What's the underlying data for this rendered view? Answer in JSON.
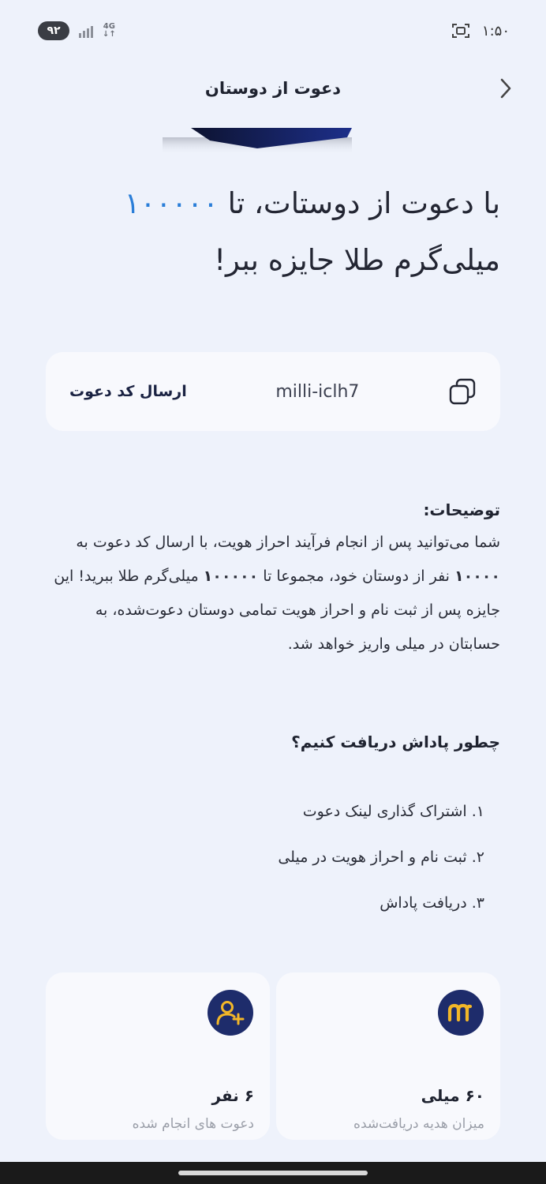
{
  "status_bar": {
    "battery": "۹۲",
    "network": "4G",
    "time": "۱:۵۰"
  },
  "header": {
    "title": "دعوت از دوستان",
    "back_icon": "chevron-right-icon"
  },
  "hero": {
    "text_before": "با دعوت از دوستات، تا ",
    "amount": "۱۰۰۰۰۰",
    "text_after": " میلی‌گرم طلا جایزه ببر!",
    "accent_color": "#2a7ed8"
  },
  "invite": {
    "send_label": "ارسال کد دعوت",
    "code": "milli-iclh7",
    "copy_icon": "copy-icon"
  },
  "description": {
    "title": "توضیحات:",
    "part1": "شما می‌توانید پس از انجام فرآیند احراز هویت، با ارسال کد دعوت به ",
    "invite_count": "۱۰۰۰۰",
    "part2": " نفر از دوستان خود، مجموعا تا ",
    "total_amount": "۱۰۰۰۰۰",
    "part3": " میلی‌گرم طلا ببرید! این جایزه پس از ثبت نام و احراز هویت تمامی دوستان دعوت‌شده، به حسابتان در میلی واریز خواهد شد."
  },
  "how_to": {
    "title": "چطور پاداش دریافت کنیم؟",
    "steps": [
      "۱. اشتراک گذاری لینک دعوت",
      "۲. ثبت نام و احراز هویت در میلی",
      "۳. دریافت پاداش"
    ]
  },
  "stats": {
    "reward": {
      "icon": "milli-logo-icon",
      "value": "۶۰ میلی",
      "label": "میزان هدیه دریافت‌شده"
    },
    "invites": {
      "icon": "add-user-icon",
      "value": "۶ نفر",
      "label": "دعوت های انجام شده"
    },
    "icon_bg": "#1e2c6b",
    "icon_fg": "#f3b728"
  }
}
